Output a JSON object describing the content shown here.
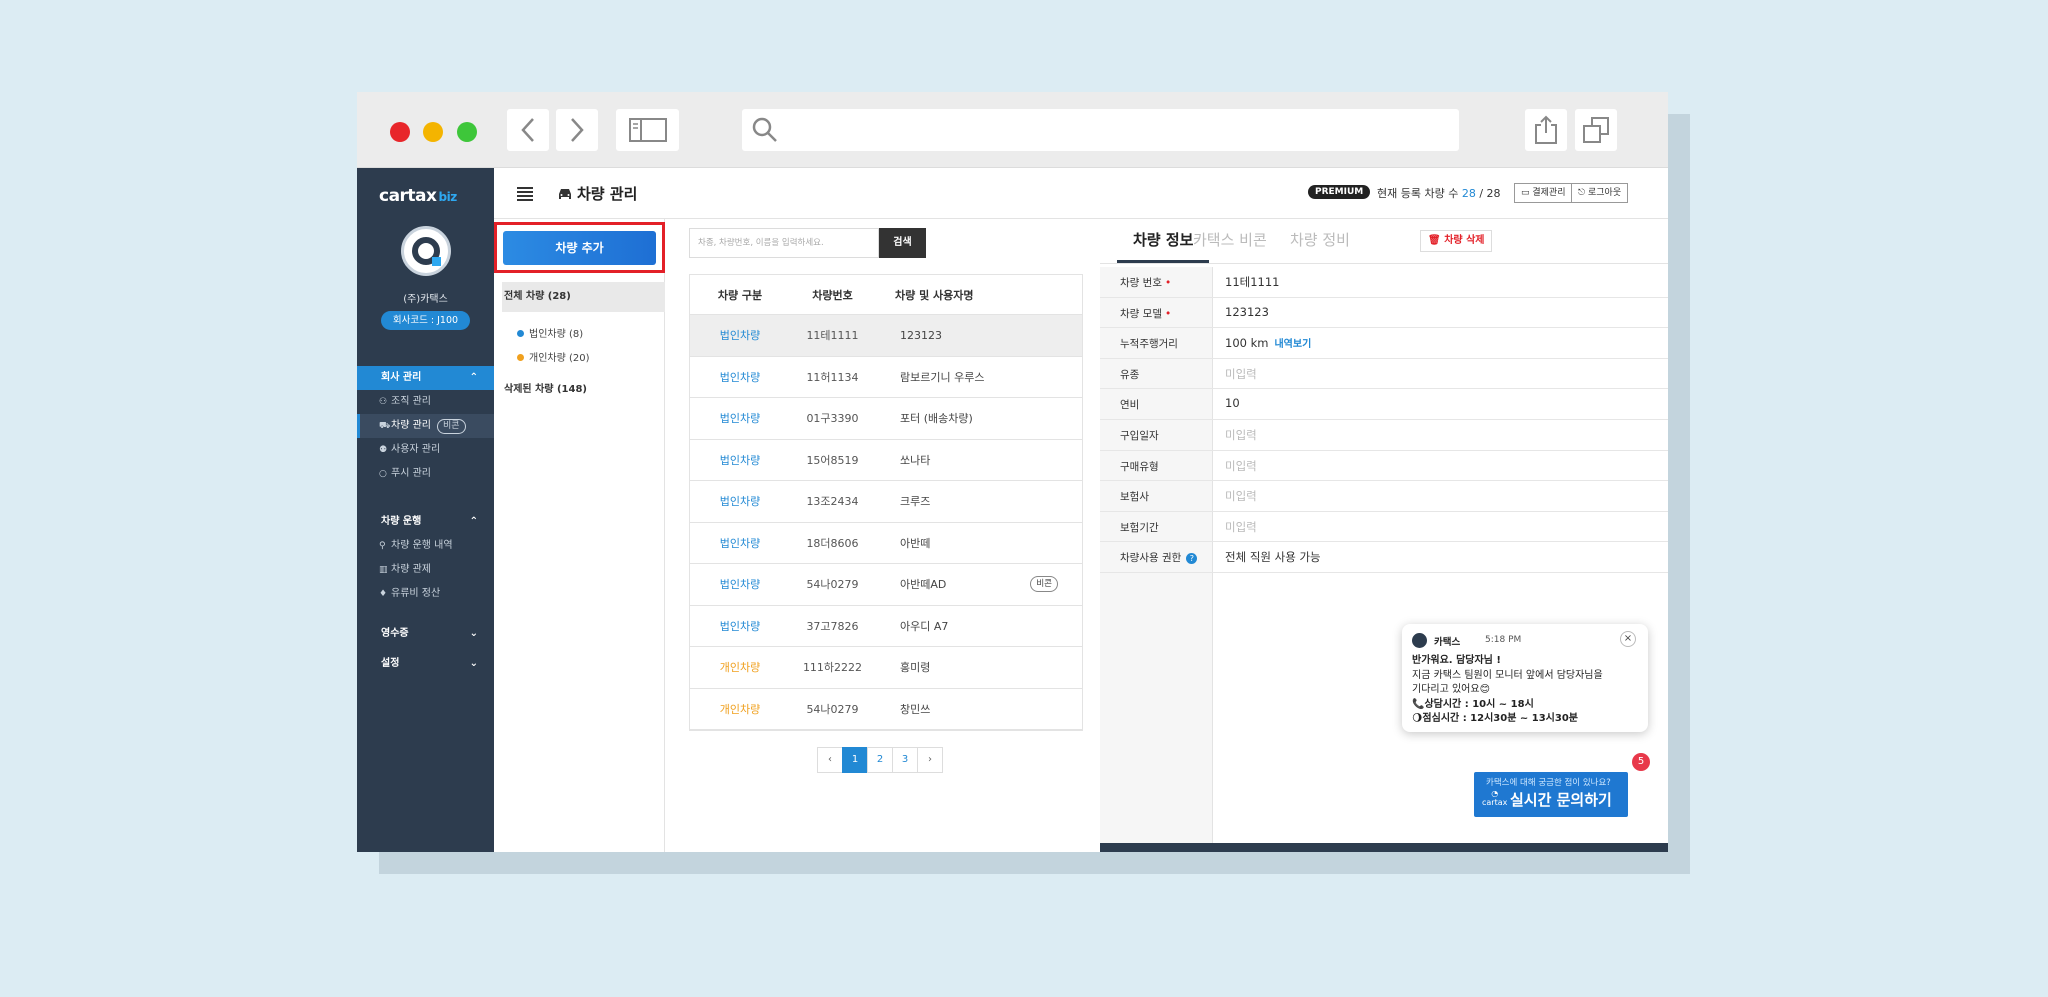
{
  "header": {
    "title": "차량 관리",
    "premium_label": "PREMIUM",
    "reg_count_label": "현재 등록 차량 수",
    "reg_count_current": "28",
    "reg_count_total": "/ 28",
    "billing_label": "결제관리",
    "logout_label": "로그아웃"
  },
  "sidebar": {
    "logo": "cartax",
    "logo_suffix": "biz",
    "company_name": "(주)카택스",
    "company_code": "회사코드 : J100",
    "groups": [
      {
        "label": "회사 관리",
        "items": [
          {
            "icon": "org-icon",
            "label": "조직 관리"
          },
          {
            "icon": "car-icon",
            "label": "차량 관리",
            "pill": "비콘"
          },
          {
            "icon": "user-icon",
            "label": "사용자 관리"
          },
          {
            "icon": "chat-icon",
            "label": "푸시 관리"
          }
        ]
      },
      {
        "label": "차량 운행",
        "items": [
          {
            "icon": "pin-icon",
            "label": "차량 운행 내역"
          },
          {
            "icon": "map-icon",
            "label": "차량 관제"
          },
          {
            "icon": "fuel-icon",
            "label": "유류비 정산"
          }
        ]
      },
      {
        "label": "영수증"
      },
      {
        "label": "설정"
      }
    ]
  },
  "filters": {
    "add_button": "차량 추가",
    "all": "전체 차량 (28)",
    "corp": "법인차량 (8)",
    "ind": "개인차량 (20)",
    "deleted": "삭제된 차량 (148)"
  },
  "search": {
    "placeholder": "차종, 차량번호, 이름을 입력하세요.",
    "button": "검색"
  },
  "table": {
    "headers": [
      "차량 구분",
      "차량번호",
      "차량 및 사용자명"
    ],
    "rows": [
      {
        "type": "법인차량",
        "plate": "11테1111",
        "name": "123123"
      },
      {
        "type": "법인차량",
        "plate": "11허1134",
        "name": "람보르기니 우루스"
      },
      {
        "type": "법인차량",
        "plate": "01구3390",
        "name": "포터 (배송차량)"
      },
      {
        "type": "법인차량",
        "plate": "15어8519",
        "name": "쏘나타"
      },
      {
        "type": "법인차량",
        "plate": "13조2434",
        "name": "크루즈"
      },
      {
        "type": "법인차량",
        "plate": "18더8606",
        "name": "아반떼"
      },
      {
        "type": "법인차량",
        "plate": "54나0279",
        "name": "아반떼AD",
        "badge": "비콘"
      },
      {
        "type": "법인차량",
        "plate": "37고7826",
        "name": "아우디 A7"
      },
      {
        "type": "개인차량",
        "plate": "111하2222",
        "name": "홍미령"
      },
      {
        "type": "개인차량",
        "plate": "54나0279",
        "name": "창민쓰"
      }
    ]
  },
  "pagination": {
    "prev": "‹",
    "pages": [
      "1",
      "2",
      "3"
    ],
    "next": "›"
  },
  "detail": {
    "tabs": [
      "차량 정보",
      "카택스 비콘",
      "차량 정비"
    ],
    "delete_button": "차량 삭제",
    "fields": [
      {
        "label": "차량 번호",
        "value": "11테1111",
        "required": true
      },
      {
        "label": "차량 모델",
        "value": "123123",
        "required": true
      },
      {
        "label": "누적주행거리",
        "value": "100 km",
        "link": "내역보기"
      },
      {
        "label": "유종",
        "value": "미입력",
        "empty": true
      },
      {
        "label": "연비",
        "value": "10"
      },
      {
        "label": "구입일자",
        "value": "미입력",
        "empty": true
      },
      {
        "label": "구매유형",
        "value": "미입력",
        "empty": true
      },
      {
        "label": "보험사",
        "value": "미입력",
        "empty": true
      },
      {
        "label": "보험기간",
        "value": "미입력",
        "empty": true
      },
      {
        "label": "차량사용 권한",
        "value": "전체 직원 사용 가능",
        "help": true
      }
    ]
  },
  "chat": {
    "from": "카택스",
    "time": "5:18 PM",
    "line1": "반가워요. 담당자님 !",
    "line2": "지금 카택스 팀원이 모니터 앞에서 담당자님을",
    "line3": "기다리고 있어요😊",
    "line4": "📞상담시간 : 10시 ~ 18시",
    "line5": "🌖점심시간 : 12시30분 ~ 13시30분",
    "close": "×"
  },
  "live_chat": {
    "small": "카택스에 대해 궁금한 점이 있나요?",
    "big": "실시간 문의하기",
    "logo": "cartax",
    "badge": "5"
  },
  "colors": {
    "accent": "#2289d4",
    "sidebar": "#2d3c4e",
    "danger": "#e32028",
    "personal": "#f0a01e"
  }
}
